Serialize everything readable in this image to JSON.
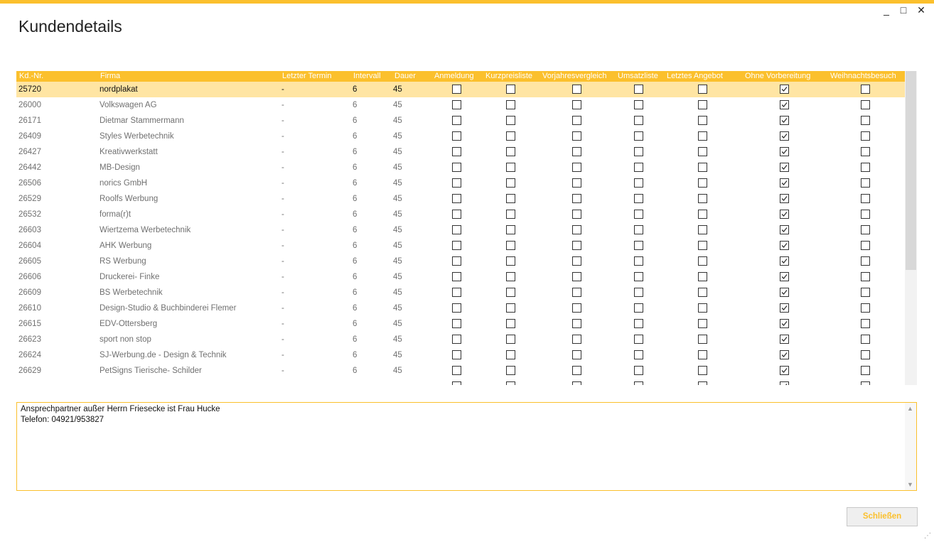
{
  "window": {
    "title": "Kundendetails",
    "min_icon": "minimize-icon",
    "max_icon": "maximize-icon",
    "close_icon": "close-icon",
    "min_glyph": "_",
    "max_glyph": "□",
    "close_glyph": "✕"
  },
  "colors": {
    "accent": "#fbc02d",
    "selected_row": "#ffe5a3"
  },
  "table": {
    "headers": [
      "Kd.-Nr.",
      "Firma",
      "Letzter Termin",
      "Intervall",
      "Dauer",
      "Anmeldung",
      "Kurzpreisliste",
      "Vorjahresvergleich",
      "Umsatzliste",
      "Letztes Angebot",
      "Ohne Vorbereitung",
      "Weihnachtsbesuch"
    ],
    "rows": [
      {
        "nr": "25720",
        "firma": "nordplakat",
        "termin": "-",
        "intervall": "6",
        "dauer": "45",
        "checks": [
          false,
          false,
          false,
          false,
          false,
          true,
          false
        ],
        "selected": true
      },
      {
        "nr": "26000",
        "firma": "Volkswagen AG",
        "termin": "-",
        "intervall": "6",
        "dauer": "45",
        "checks": [
          false,
          false,
          false,
          false,
          false,
          true,
          false
        ]
      },
      {
        "nr": "26171",
        "firma": "Dietmar Stammermann",
        "termin": "-",
        "intervall": "6",
        "dauer": "45",
        "checks": [
          false,
          false,
          false,
          false,
          false,
          true,
          false
        ]
      },
      {
        "nr": "26409",
        "firma": "Styles Werbetechnik",
        "termin": "-",
        "intervall": "6",
        "dauer": "45",
        "checks": [
          false,
          false,
          false,
          false,
          false,
          true,
          false
        ]
      },
      {
        "nr": "26427",
        "firma": "Kreativwerkstatt",
        "termin": "-",
        "intervall": "6",
        "dauer": "45",
        "checks": [
          false,
          false,
          false,
          false,
          false,
          true,
          false
        ]
      },
      {
        "nr": "26442",
        "firma": "MB-Design",
        "termin": "-",
        "intervall": "6",
        "dauer": "45",
        "checks": [
          false,
          false,
          false,
          false,
          false,
          true,
          false
        ]
      },
      {
        "nr": "26506",
        "firma": "norics GmbH",
        "termin": "-",
        "intervall": "6",
        "dauer": "45",
        "checks": [
          false,
          false,
          false,
          false,
          false,
          true,
          false
        ]
      },
      {
        "nr": "26529",
        "firma": "Roolfs Werbung",
        "termin": "-",
        "intervall": "6",
        "dauer": "45",
        "checks": [
          false,
          false,
          false,
          false,
          false,
          true,
          false
        ]
      },
      {
        "nr": "26532",
        "firma": "forma(r)t",
        "termin": "-",
        "intervall": "6",
        "dauer": "45",
        "checks": [
          false,
          false,
          false,
          false,
          false,
          true,
          false
        ]
      },
      {
        "nr": "26603",
        "firma": "Wiertzema Werbetechnik",
        "termin": "-",
        "intervall": "6",
        "dauer": "45",
        "checks": [
          false,
          false,
          false,
          false,
          false,
          true,
          false
        ]
      },
      {
        "nr": "26604",
        "firma": "AHK Werbung",
        "termin": "-",
        "intervall": "6",
        "dauer": "45",
        "checks": [
          false,
          false,
          false,
          false,
          false,
          true,
          false
        ]
      },
      {
        "nr": "26605",
        "firma": "RS Werbung",
        "termin": "-",
        "intervall": "6",
        "dauer": "45",
        "checks": [
          false,
          false,
          false,
          false,
          false,
          true,
          false
        ]
      },
      {
        "nr": "26606",
        "firma": "Druckerei- Finke",
        "termin": "-",
        "intervall": "6",
        "dauer": "45",
        "checks": [
          false,
          false,
          false,
          false,
          false,
          true,
          false
        ]
      },
      {
        "nr": "26609",
        "firma": "BS Werbetechnik",
        "termin": "-",
        "intervall": "6",
        "dauer": "45",
        "checks": [
          false,
          false,
          false,
          false,
          false,
          true,
          false
        ]
      },
      {
        "nr": "26610",
        "firma": "Design-Studio & Buchbinderei Flemer",
        "termin": "-",
        "intervall": "6",
        "dauer": "45",
        "checks": [
          false,
          false,
          false,
          false,
          false,
          true,
          false
        ]
      },
      {
        "nr": "26615",
        "firma": "EDV-Ottersberg",
        "termin": "-",
        "intervall": "6",
        "dauer": "45",
        "checks": [
          false,
          false,
          false,
          false,
          false,
          true,
          false
        ]
      },
      {
        "nr": "26623",
        "firma": "sport non stop",
        "termin": "-",
        "intervall": "6",
        "dauer": "45",
        "checks": [
          false,
          false,
          false,
          false,
          false,
          true,
          false
        ]
      },
      {
        "nr": "26624",
        "firma": "SJ-Werbung.de - Design & Technik",
        "termin": "-",
        "intervall": "6",
        "dauer": "45",
        "checks": [
          false,
          false,
          false,
          false,
          false,
          true,
          false
        ]
      },
      {
        "nr": "26629",
        "firma": "PetSigns Tierische- Schilder",
        "termin": "-",
        "intervall": "6",
        "dauer": "45",
        "checks": [
          false,
          false,
          false,
          false,
          false,
          true,
          false
        ]
      },
      {
        "nr": "",
        "firma": "",
        "termin": "",
        "intervall": "",
        "dauer": "",
        "checks": [
          false,
          false,
          false,
          false,
          false,
          true,
          false
        ]
      }
    ]
  },
  "notes": {
    "line1": "Ansprechpartner außer Herrn Friesecke ist Frau Hucke",
    "line2": "Telefon: 04921/953827"
  },
  "footer": {
    "close_label": "Schließen"
  }
}
